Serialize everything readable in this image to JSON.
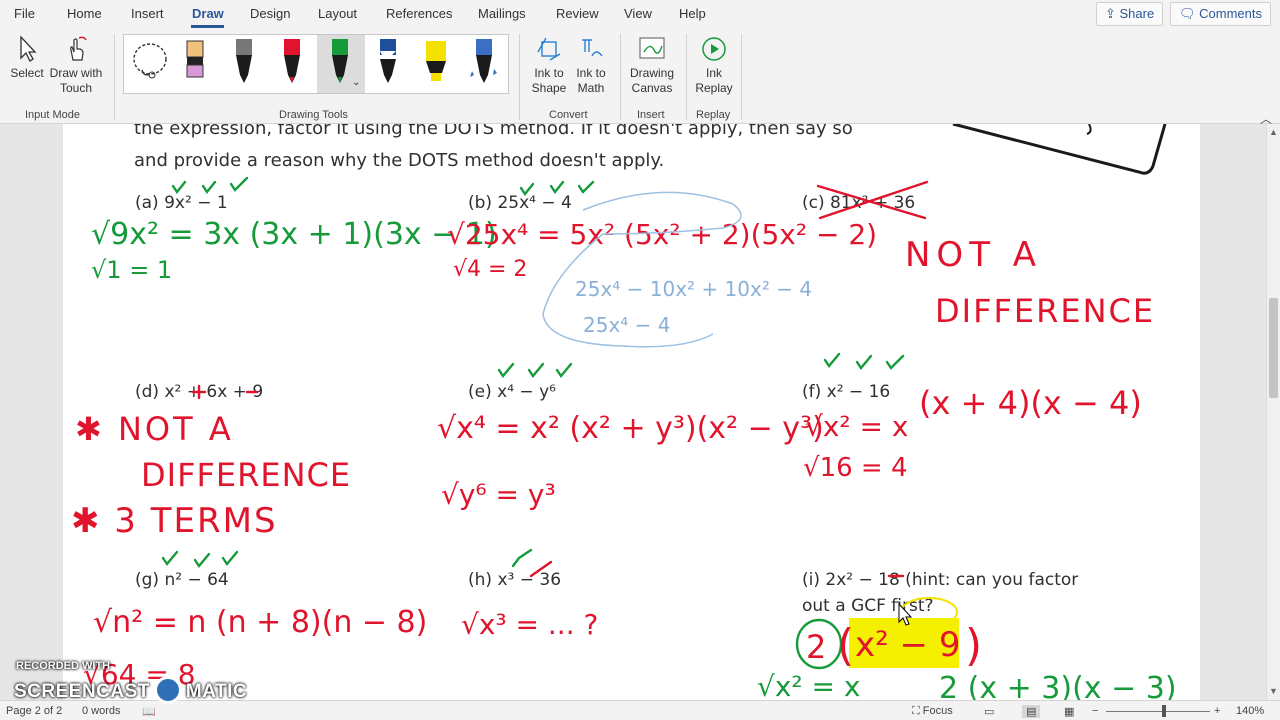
{
  "menu": {
    "items": [
      "File",
      "Home",
      "Insert",
      "Draw",
      "Design",
      "Layout",
      "References",
      "Mailings",
      "Review",
      "View",
      "Help"
    ],
    "active": "Draw",
    "share_label": "Share",
    "comments_label": "Comments"
  },
  "ribbon": {
    "input_mode": {
      "select_label": "Select",
      "draw_touch_label": "Draw with Touch",
      "group_label": "Input Mode"
    },
    "drawing_tools": {
      "group_label": "Drawing Tools"
    },
    "convert": {
      "ink_shape_label": "Ink to Shape",
      "ink_math_label": "Ink to Math",
      "group_label": "Convert"
    },
    "insert": {
      "canvas_label": "Drawing Canvas",
      "group_label": "Insert"
    },
    "replay": {
      "ink_replay_label": "Ink Replay",
      "group_label": "Replay"
    }
  },
  "document": {
    "instructions_line1": "the expression, factor it using the DOTS method.  If it doesn't apply, then say so",
    "instructions_line2": "and provide a reason why the DOTS method doesn't apply.",
    "problems": [
      {
        "letter": "(a)",
        "expr": "9x² − 1"
      },
      {
        "letter": "(b)",
        "expr": "25x⁴ − 4"
      },
      {
        "letter": "(c)",
        "expr": "81x² + 36"
      },
      {
        "letter": "(d)",
        "expr": "x² + 6x + 9"
      },
      {
        "letter": "(e)",
        "expr": "x⁴ − y⁶"
      },
      {
        "letter": "(f)",
        "expr": "x² − 16"
      },
      {
        "letter": "(g)",
        "expr": "n² − 64"
      },
      {
        "letter": "(h)",
        "expr": "x³ − 36"
      },
      {
        "letter": "(i)",
        "expr": "2x² − 18 (hint: can you factor"
      }
    ],
    "problem_i_line2": "out a GCF first?",
    "ink": {
      "a_line1": "√9x² = 3x   (3x + 1)(3x − 1)",
      "a_line2": "√1 = 1",
      "b_line1": "√25x⁴ = 5x²   (5x² + 2)(5x² − 2)",
      "b_line2": "√4 = 2",
      "b_scratch1": "25x⁴ − 10x² + 10x² − 4",
      "b_scratch2": "25x⁴ − 4",
      "c_note1": "NOT A",
      "c_note2": "DIFFERENCE",
      "d_note1": "✱ NOT A",
      "d_note2": "DIFFERENCE",
      "d_note3": "✱ 3  TERMS",
      "e_line1": "√x⁴ = x²  (x² + y³)(x² − y³)",
      "e_line2": "√y⁶ = y³",
      "f_line1": "√x² = x",
      "f_factor": "(x + 4)(x − 4)",
      "f_line2": "√16 = 4",
      "g_line1": "√n² = n    (n + 8)(n − 8)",
      "g_line2": "√64 = 8",
      "h_line1": "√x³ = ... ?",
      "i_gcf": "2",
      "i_inner": "x² − 9",
      "i_line2": "√x² = x",
      "i_factor": "2 (x + 3)(x − 3)"
    }
  },
  "status": {
    "page": "Page 2 of 2",
    "words": "0 words",
    "focus": "Focus",
    "zoom": "140%"
  },
  "watermark": {
    "line1": "RECORDED WITH",
    "line2a": "SCREENCAST",
    "line2b": "MATIC"
  }
}
